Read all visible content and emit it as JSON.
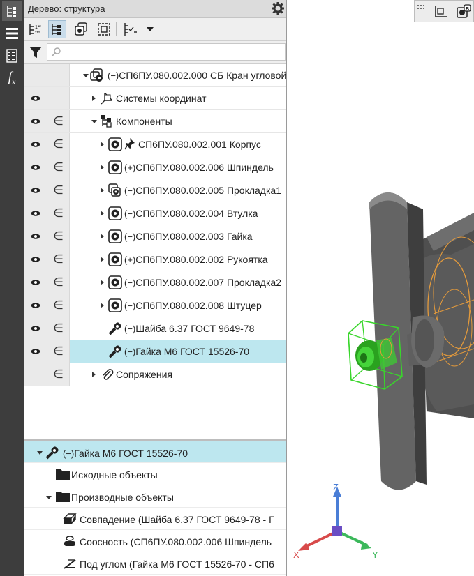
{
  "panel": {
    "title": "Дерево: структура",
    "search_placeholder": ""
  },
  "tree": {
    "root": {
      "label": "СП6ПУ.080.002.000 СБ Кран угловой"
    },
    "items": [
      {
        "label": "Системы координат"
      },
      {
        "label": "Компоненты"
      },
      {
        "label": "СП6ПУ.080.002.001 Корпус"
      },
      {
        "label": "СП6ПУ.080.002.006 Шпиндель"
      },
      {
        "label": "СП6ПУ.080.002.005 Прокладка1"
      },
      {
        "label": "СП6ПУ.080.002.004 Втулка"
      },
      {
        "label": "СП6ПУ.080.002.003 Гайка"
      },
      {
        "label": "СП6ПУ.080.002.002 Рукоятка"
      },
      {
        "label": "СП6ПУ.080.002.007 Прокладка2"
      },
      {
        "label": "СП6ПУ.080.002.008 Штуцер"
      },
      {
        "label": "Шайба 6.37 ГОСТ 9649-78"
      },
      {
        "label": "Гайка М6 ГОСТ 15526-70"
      },
      {
        "label": "Сопряжения"
      }
    ],
    "include_symbol": "∈"
  },
  "props": {
    "items": [
      {
        "label": "Гайка М6 ГОСТ 15526-70"
      },
      {
        "label": "Исходные объекты"
      },
      {
        "label": "Производные объекты"
      },
      {
        "label": "Совпадение (Шайба 6.37 ГОСТ 9649-78  -  Г"
      },
      {
        "label": "Соосность (СП6ПУ.080.002.006 Шпиндель"
      },
      {
        "label": "Под углом (Гайка М6 ГОСТ 15526-70  -  СП6"
      }
    ]
  },
  "viewport": {
    "axes": {
      "x": "X",
      "y": "Y",
      "z": "Z"
    }
  },
  "colors": {
    "selection": "#bde7ef",
    "highlight_green": "#39d62b",
    "wire_orange": "#e39a3c",
    "part_gray": "#5a5a5a"
  }
}
